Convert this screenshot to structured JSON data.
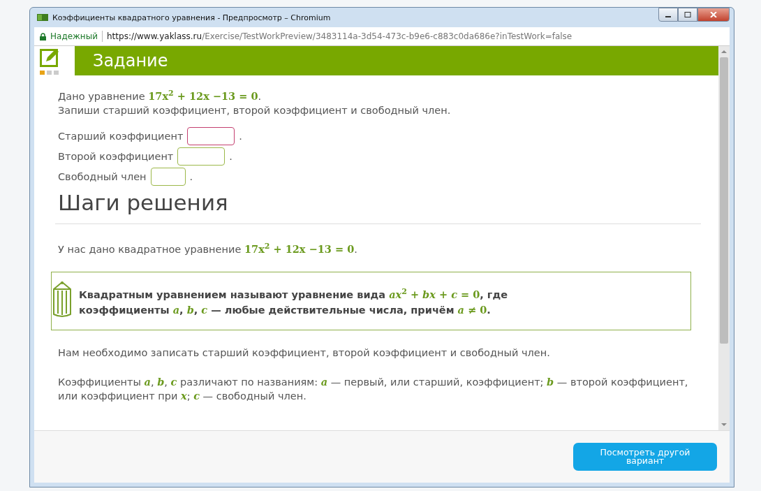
{
  "window": {
    "title": "Коэффициенты квадратного уравнения - Предпросмотр – Chromium"
  },
  "address_bar": {
    "security": "Надежный",
    "url_host": "https://www.yaklass.ru",
    "url_path": "/Exercise/TestWorkPreview/3483114a-3d54-473c-b9e6-c883c0da686e?inTestWork=false"
  },
  "header": {
    "title": "Задание"
  },
  "task": [
    {
      "parts": [
        {
          "kind": "text",
          "text": "Дано уравнение "
        },
        {
          "kind": "math",
          "text": "17x$^{2}$ + 12x −13 = 0"
        },
        {
          "kind": "text",
          "text": "."
        }
      ]
    },
    {
      "parts": [
        {
          "kind": "text",
          "text": "Запиши старший коэффициент, второй коэффициент и свободный член."
        }
      ]
    }
  ],
  "fields": [
    {
      "label": "Старший коэффициент",
      "suffix": ".",
      "focused": true
    },
    {
      "label": "Второй коэффициент",
      "suffix": ".",
      "focused": false
    },
    {
      "label": "Свободный член",
      "suffix": ".",
      "focused": false
    }
  ],
  "solution": {
    "title": "Шаги решения",
    "blocks": [
      {
        "kind": "paragraph",
        "parts": [
          {
            "kind": "text",
            "text": "У нас дано квадратное уравнение "
          },
          {
            "kind": "math",
            "text": "17x$^{2}$ + 12x −13 = 0"
          },
          {
            "kind": "text",
            "text": "."
          }
        ]
      },
      {
        "kind": "note",
        "parts": [
          {
            "kind": "text",
            "text": "Квадратным уравнением называют уравнение вида "
          },
          {
            "kind": "math",
            "text": "*ax*$^{2}$ + *bx* + *c* = 0"
          },
          {
            "kind": "text",
            "text": ", где коэффициенты "
          },
          {
            "kind": "math",
            "text": "*a*"
          },
          {
            "kind": "text",
            "text": ", "
          },
          {
            "kind": "math",
            "text": "*b*"
          },
          {
            "kind": "text",
            "text": ", "
          },
          {
            "kind": "math",
            "text": "*c*"
          },
          {
            "kind": "text",
            "text": " — любые действительные числа, причём "
          },
          {
            "kind": "math",
            "text": "*a* ≠ 0"
          },
          {
            "kind": "text",
            "text": "."
          }
        ]
      },
      {
        "kind": "paragraph",
        "parts": [
          {
            "kind": "text",
            "text": "Нам необходимо записать старший коэффициент, второй коэффициент и свободный член."
          }
        ]
      },
      {
        "kind": "paragraph",
        "parts": [
          {
            "kind": "text",
            "text": "Коэффициенты "
          },
          {
            "kind": "math",
            "text": "*a*"
          },
          {
            "kind": "text",
            "text": ", "
          },
          {
            "kind": "math",
            "text": "*b*"
          },
          {
            "kind": "text",
            "text": ", "
          },
          {
            "kind": "math",
            "text": "*c*"
          },
          {
            "kind": "text",
            "text": " различают по названиям: "
          },
          {
            "kind": "math",
            "text": "*a*"
          },
          {
            "kind": "text",
            "text": " — первый, или старший, коэффициент; "
          },
          {
            "kind": "math",
            "text": "*b*"
          },
          {
            "kind": "text",
            "text": " — второй коэффициент, или коэффициент при "
          },
          {
            "kind": "math",
            "text": "*x*"
          },
          {
            "kind": "text",
            "text": "; "
          },
          {
            "kind": "math",
            "text": "*c*"
          },
          {
            "kind": "text",
            "text": " — свободный член."
          }
        ]
      }
    ]
  },
  "footer": {
    "button": "Посмотреть другой вариант"
  }
}
